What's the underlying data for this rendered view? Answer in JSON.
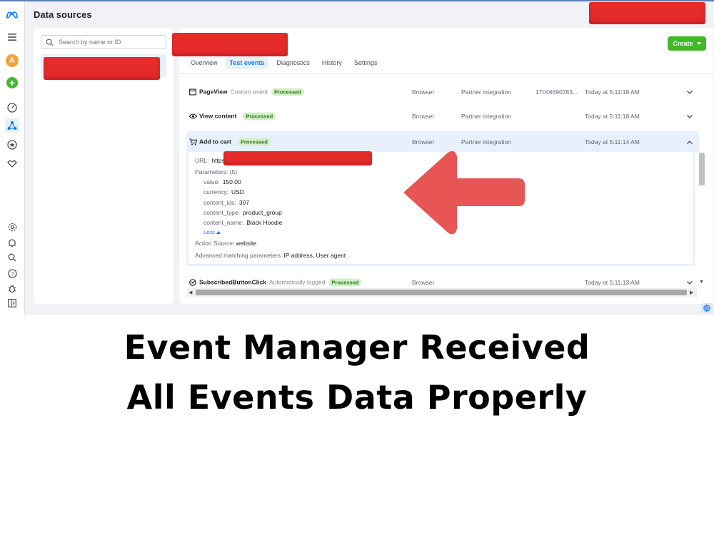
{
  "header": {
    "title": "Data sources"
  },
  "rail": {
    "avatar_letter": "A",
    "icons": [
      "meta-logo-icon",
      "menu-icon",
      "avatar",
      "add-icon",
      "gauge-icon",
      "events-manager-icon",
      "star-icon",
      "partner-icon",
      "settings-icon",
      "bell-icon",
      "search-icon",
      "help-icon",
      "bug-icon",
      "panel-icon"
    ]
  },
  "search": {
    "placeholder": "Search by name or ID"
  },
  "create_button": {
    "label": "Create"
  },
  "tabs": [
    {
      "label": "Overview"
    },
    {
      "label": "Test events"
    },
    {
      "label": "Diagnostics"
    },
    {
      "label": "History"
    },
    {
      "label": "Settings"
    }
  ],
  "events": [
    {
      "name": "PageView",
      "sub": "Custom event",
      "status": "Processed",
      "source": "Browser",
      "integration": "Partner integration",
      "id": "17046690783...",
      "time": "Today at 5:11:18 AM"
    },
    {
      "name": "View content",
      "sub": "",
      "status": "Processed",
      "source": "Browser",
      "integration": "Partner integration",
      "id": "",
      "time": "Today at 5:11:18 AM"
    },
    {
      "name": "Add to cart",
      "sub": "",
      "status": "Processed",
      "source": "Browser",
      "integration": "Partner integration",
      "id": "",
      "time": "Today at 5:11:14 AM"
    },
    {
      "name": "SubscribedButtonClick",
      "sub": "Automatically logged",
      "status": "Processed",
      "source": "Browser",
      "integration": "",
      "id": "",
      "time": "Today at 5:11:13 AM"
    }
  ],
  "details": {
    "url_label": "URL:",
    "url_value": "https:",
    "parameters_label": "Parameters: (5)",
    "params": [
      {
        "key": "value:",
        "val": "150.00"
      },
      {
        "key": "currency:",
        "val": "USD"
      },
      {
        "key": "content_ids:",
        "val": "307"
      },
      {
        "key": "content_type:",
        "val": "product_group"
      },
      {
        "key": "content_name:",
        "val": "Black Hoodie"
      }
    ],
    "less_label": "Less",
    "action_source_label": "Action Source:",
    "action_source_value": "website",
    "adv_label": "Advanced matching parameters:",
    "adv_value": "IP address, User agent"
  },
  "caption": {
    "line1": "Event Manager Received",
    "line2": "All Events Data Properly"
  },
  "colors": {
    "accent": "#1877f2",
    "create_green": "#42b72a",
    "redaction": "#e62b2b",
    "arrow": "#e85555"
  }
}
